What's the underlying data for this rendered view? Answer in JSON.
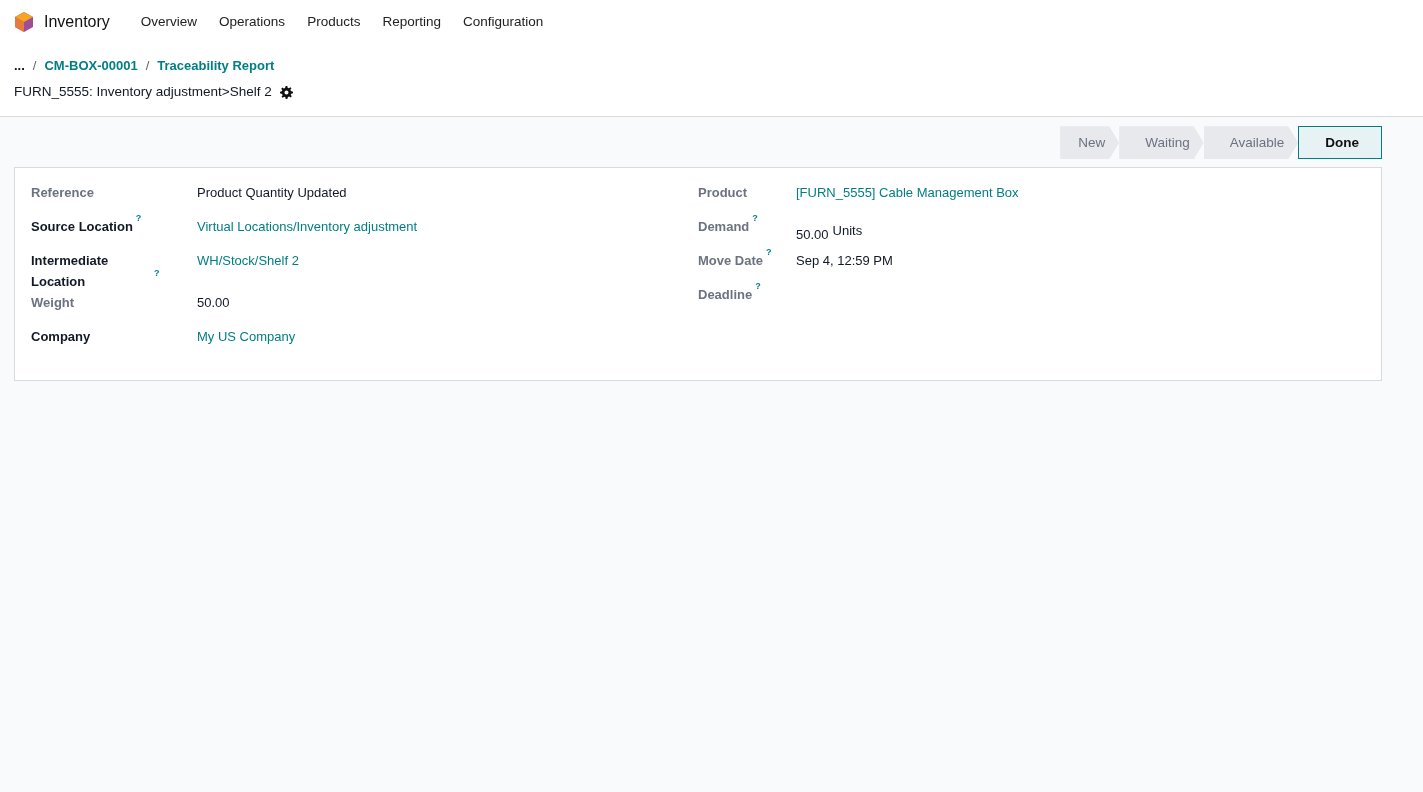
{
  "app": {
    "name": "Inventory"
  },
  "menu": [
    "Overview",
    "Operations",
    "Products",
    "Reporting",
    "Configuration"
  ],
  "breadcrumb": {
    "ellipsis": "...",
    "separator": "/",
    "items": [
      "CM-BOX-00001",
      "Traceability Report"
    ]
  },
  "record_title": "FURN_5555: Inventory adjustment>Shelf 2",
  "status_stages": [
    {
      "label": "New",
      "selected": false
    },
    {
      "label": "Waiting",
      "selected": false
    },
    {
      "label": "Available",
      "selected": false
    },
    {
      "label": "Done",
      "selected": true
    }
  ],
  "left_fields": [
    {
      "label": "Reference",
      "required": false,
      "kind": "text",
      "value": "Product Quantity Updated"
    },
    {
      "label": "Source Location",
      "required": true,
      "help": "?",
      "kind": "link",
      "value": "Virtual Locations/Inventory adjustment"
    },
    {
      "label": "Intermediate Location",
      "required": true,
      "help": "?",
      "kind": "link",
      "value": "WH/Stock/Shelf 2"
    },
    {
      "label": "Weight",
      "required": false,
      "kind": "text",
      "value": "50.00"
    },
    {
      "label": "Company",
      "required": true,
      "kind": "link",
      "value": "My US Company"
    }
  ],
  "right_fields": [
    {
      "label": "Product",
      "required": false,
      "kind": "link",
      "value": "[FURN_5555] Cable Management Box"
    },
    {
      "label": "Demand",
      "required": false,
      "help": "?",
      "kind": "quantity",
      "value": "50.00",
      "unit": "Units"
    },
    {
      "label": "Move Date",
      "required": false,
      "help": "?",
      "kind": "text",
      "value": "Sep 4, 12:59 PM"
    },
    {
      "label": "Deadline",
      "required": false,
      "help": "?",
      "kind": "empty"
    }
  ]
}
